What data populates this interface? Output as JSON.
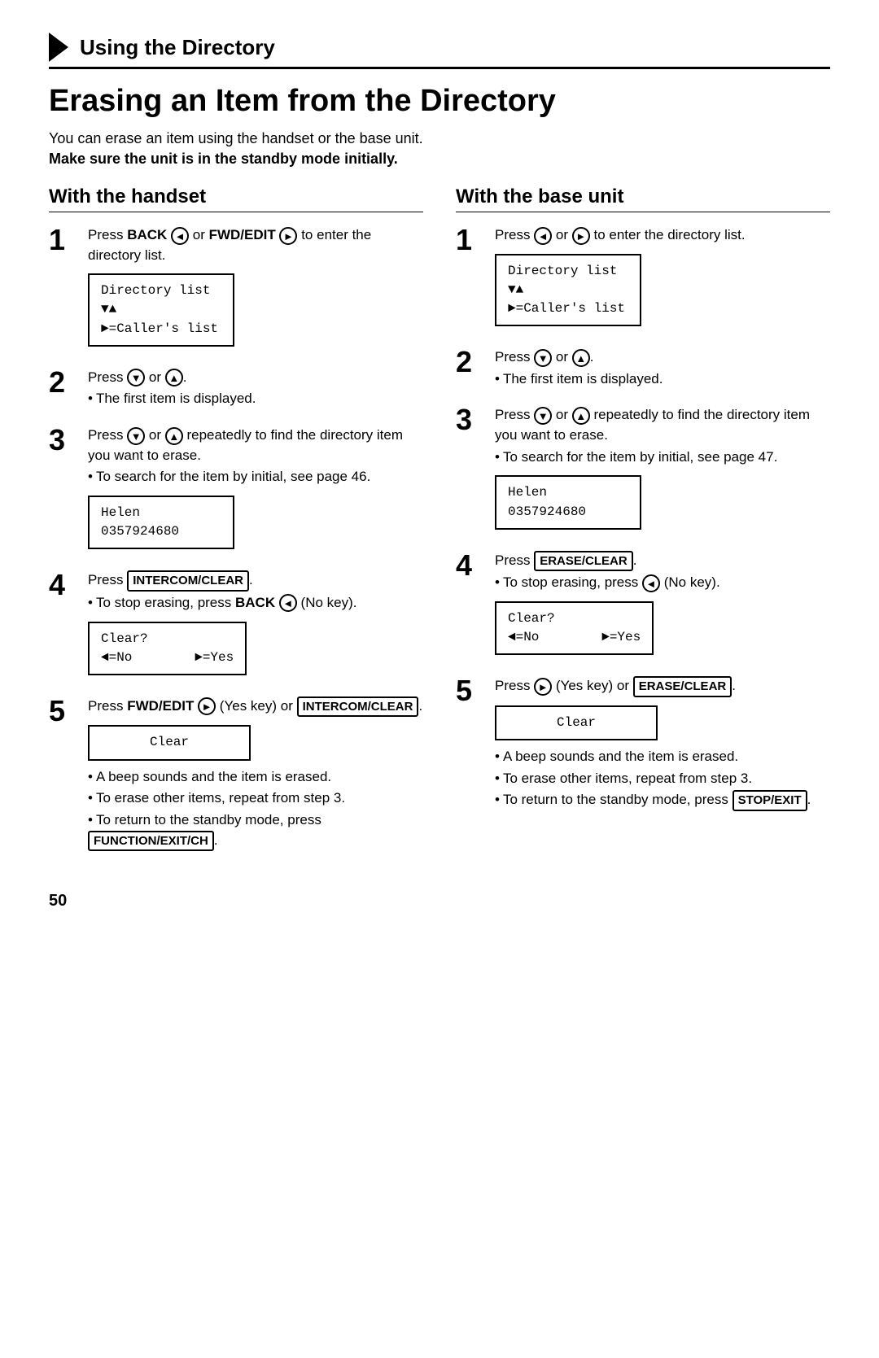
{
  "header": {
    "arrow": "→",
    "title": "Using the Directory"
  },
  "page_title": "Erasing an Item from the Directory",
  "intro": {
    "line1": "You can erase an item using the handset or the base unit.",
    "line2_bold": "Make sure the unit is in the standby mode initially."
  },
  "handset": {
    "col_title": "With the handset",
    "steps": [
      {
        "num": "1",
        "main": "Press BACK ◄ or FWD/EDIT ► to enter the directory list.",
        "screen": [
          "Directory list",
          "▼▲",
          "►=Caller's list"
        ]
      },
      {
        "num": "2",
        "main": "Press ▼ or ▲.",
        "bullet": "The first item is displayed."
      },
      {
        "num": "3",
        "main": "Press ▼ or ▲ repeatedly to find the directory item you want to erase.",
        "bullet": "To search for the item by initial, see page 46.",
        "screen": [
          "Helen",
          "0357924680"
        ]
      },
      {
        "num": "4",
        "main": "Press INTERCOM/CLEAR.",
        "bullet1": "To stop erasing, press BACK ◄ (No key).",
        "screen": [
          "Clear?",
          "◄=No        ►=Yes"
        ]
      },
      {
        "num": "5",
        "main": "Press FWD/EDIT ► (Yes key) or INTERCOM/CLEAR.",
        "screen_center": "Clear",
        "bullets": [
          "A beep sounds and the item is erased.",
          "To erase other items, repeat from step 3.",
          "To return to the standby mode, press FUNCTION/EXIT/CH."
        ]
      }
    ]
  },
  "base_unit": {
    "col_title": "With the base unit",
    "steps": [
      {
        "num": "1",
        "main": "Press ◄ or ► to enter the directory list.",
        "screen": [
          "Directory list",
          "▼▲",
          "►=Caller's list"
        ]
      },
      {
        "num": "2",
        "main": "Press ▼ or ▲.",
        "bullet": "The first item is displayed."
      },
      {
        "num": "3",
        "main": "Press ▼ or ▲ repeatedly to find the directory item you want to erase.",
        "bullet": "To search for the item by initial, see page 47.",
        "screen": [
          "Helen",
          "0357924680"
        ]
      },
      {
        "num": "4",
        "main": "Press ERASE/CLEAR.",
        "bullet1": "To stop erasing, press ◄ (No key).",
        "screen": [
          "Clear?",
          "◄=No        ►=Yes"
        ]
      },
      {
        "num": "5",
        "main": "Press ► (Yes key) or ERASE/CLEAR.",
        "screen_center": "Clear",
        "bullets": [
          "A beep sounds and the item is erased.",
          "To erase other items, repeat from step 3.",
          "To return to the standby mode, press STOP/EXIT."
        ]
      }
    ]
  },
  "page_number": "50"
}
